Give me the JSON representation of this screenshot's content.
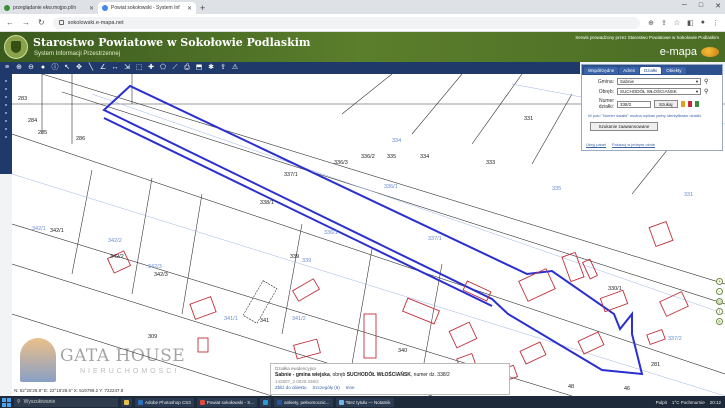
{
  "browser": {
    "tabs": [
      {
        "label": "przeglądanie ekw.mojpo.pl/n"
      },
      {
        "label": "Powiat sokołowski - System Inf"
      },
      {
        "label": ""
      }
    ],
    "url": "sokolowski.e-mapa.net"
  },
  "header": {
    "title": "Starostwo Powiatowe w Sokołowie Podlaskim",
    "subtitle": "System Informacji Przestrzennej",
    "right_info": "Serwis prowadzony przez Starostwo Powiatowe w Sokołowie Podlaskim",
    "brand": "e-mapa"
  },
  "map": {
    "parcels": [
      {
        "label": "283",
        "blue": false
      },
      {
        "label": "284",
        "blue": false
      },
      {
        "label": "285",
        "blue": false
      },
      {
        "label": "286",
        "blue": false
      },
      {
        "label": "331",
        "blue": false
      },
      {
        "label": "334",
        "blue": true
      },
      {
        "label": "336/3",
        "blue": false
      },
      {
        "label": "336/2",
        "blue": false
      },
      {
        "label": "335",
        "blue": false
      },
      {
        "label": "334",
        "blue": false
      },
      {
        "label": "333",
        "blue": false
      },
      {
        "label": "337/1",
        "blue": false
      },
      {
        "label": "336/1",
        "blue": true
      },
      {
        "label": "335",
        "blue": true
      },
      {
        "label": "338/1",
        "blue": false
      },
      {
        "label": "331",
        "blue": true
      },
      {
        "label": "342/1",
        "blue": true
      },
      {
        "label": "342/1",
        "blue": false
      },
      {
        "label": "336/1",
        "blue": true
      },
      {
        "label": "337/1",
        "blue": true
      },
      {
        "label": "342/2",
        "blue": true
      },
      {
        "label": "342/2",
        "blue": false
      },
      {
        "label": "342/3",
        "blue": true
      },
      {
        "label": "342/3",
        "blue": false
      },
      {
        "label": "339",
        "blue": false
      },
      {
        "label": "339",
        "blue": true
      },
      {
        "label": "341/1",
        "blue": true
      },
      {
        "label": "341/2",
        "blue": true
      },
      {
        "label": "341",
        "blue": false
      },
      {
        "label": "340",
        "blue": false
      },
      {
        "label": "309",
        "blue": false
      },
      {
        "label": "281",
        "blue": false
      },
      {
        "label": "337/2",
        "blue": true
      },
      {
        "label": "330/1",
        "blue": false
      },
      {
        "label": "55",
        "blue": false
      },
      {
        "label": "48",
        "blue": false
      },
      {
        "label": "46",
        "blue": false
      }
    ]
  },
  "watermark": {
    "name": "GATA HOUSE",
    "sub": "NIERUCHOMOŚCI"
  },
  "coords": "N: 52°25'28.8\"  E: 22°16'28.6\"  X: 519799.2  Y: 722247.8",
  "panel": {
    "tabs": [
      "Współrzędne",
      "Adres",
      "Działki",
      "Obiekty"
    ],
    "active_tab": "Działki",
    "gmina_label": "Gmina:",
    "gmina_value": "Sabnie",
    "obreb_label": "Obręb:",
    "obreb_value": "SUCHODÓŁ WŁOŚCIAŃSK",
    "nr_label": "Numer działki:",
    "nr_value": "338/2",
    "search_btn": "Szukaj",
    "hint": "W polu \"Numer działki\" można wpisać pełny identyfikator działki.",
    "advanced_btn": "Szukanie zaawansowane",
    "link1": "Ukryj panel",
    "link2": "Pokazuj w jednym oknie"
  },
  "popup": {
    "title": "Działka ewidencyjna",
    "desc_prefix": "Sabnie - gmina wiejska",
    "desc_mid": ", obręb ",
    "desc_obreb": "SUCHODÓŁ WŁOŚCIAŃSK",
    "desc_num": ", numer dz. 338/2",
    "id": "142807_2.0020.338/2",
    "link1": "Zbliż do obiektu",
    "link2": "Szczegóły (6)",
    "link3": "Inne"
  },
  "taskbar": {
    "search_placeholder": "Wyszukiwanie",
    "apps": [
      "Adobe Photoshop CS3",
      "Powiat sokołowski - S...",
      "ankiety, pełnomocnic...",
      "*Bez tytułu — Notatnik"
    ],
    "tray_text": "Pulpit",
    "weather": "1°C  Pochmurnie",
    "time": "20:12"
  },
  "colors": {
    "highlight": "#2a2fd0",
    "building": "#c0303a",
    "toolbar": "#1f3a6a",
    "banner": "#4f7226"
  }
}
